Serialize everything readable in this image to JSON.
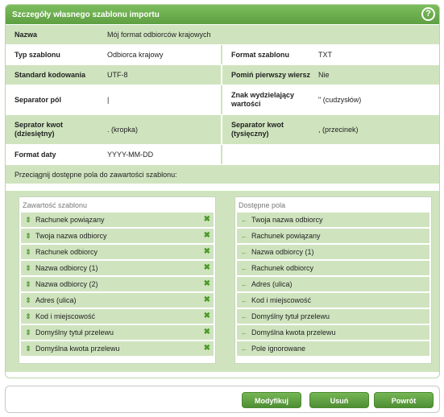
{
  "panel": {
    "title": "Szczegóły własnego szablonu importu",
    "help_icon": "?"
  },
  "fields": {
    "nazwa_label": "Nazwa",
    "nazwa_value": "Mój format odbiorców krajowych",
    "typ_label": "Typ szablonu",
    "typ_value": "Odbiorca krajowy",
    "format_label": "Format szablonu",
    "format_value": "TXT",
    "standard_label": "Standard kodowania",
    "standard_value": "UTF-8",
    "pomin_label": "Pomiń pierwszy wiersz",
    "pomin_value": "Nie",
    "separator_pol_label": "Separator pól",
    "separator_pol_value": "|",
    "znak_label": "Znak wydzielający wartości",
    "znak_value": "\" (cudzysłów)",
    "sep_kwot_dz_label": "Seprator kwot (dziesiętny)",
    "sep_kwot_dz_value": ". (kropka)",
    "sep_kwot_ty_label": "Separator kwot (tysięczny)",
    "sep_kwot_ty_value": ", (przecinek)",
    "format_daty_label": "Format daty",
    "format_daty_value": "YYYY-MM-DD"
  },
  "drag_hint": "Przeciągnij dostępne pola do zawartości szablonu:",
  "template_box": {
    "title": "Zawartość szablonu",
    "items": [
      "Rachunek powiązany",
      "Twoja nazwa odbiorcy",
      "Rachunek odbiorcy",
      "Nazwa odbiorcy (1)",
      "Nazwa odbiorcy (2)",
      "Adres (ulica)",
      "Kod i miejscowość",
      "Domyślny tytuł przelewu",
      "Domyślna kwota przelewu"
    ],
    "grip_glyph": "⇕",
    "remove_glyph": "✖"
  },
  "available_box": {
    "title": "Dostępne pola",
    "items": [
      "Twoja nazwa odbiorcy",
      "Rachunek powiązany",
      "Nazwa odbiorcy (1)",
      "Rachunek odbiorcy",
      "Adres (ulica)",
      "Kod i miejscowość",
      "Domyślny tytuł przelewu",
      "Domyślna kwota przelewu",
      "Pole ignorowane"
    ],
    "arrow_glyph": "←"
  },
  "buttons": {
    "modify": "Modyfikuj",
    "delete": "Usuń",
    "back": "Powrót"
  },
  "colors": {
    "accent": "#5e9f41",
    "row_green": "#cfe4be"
  }
}
